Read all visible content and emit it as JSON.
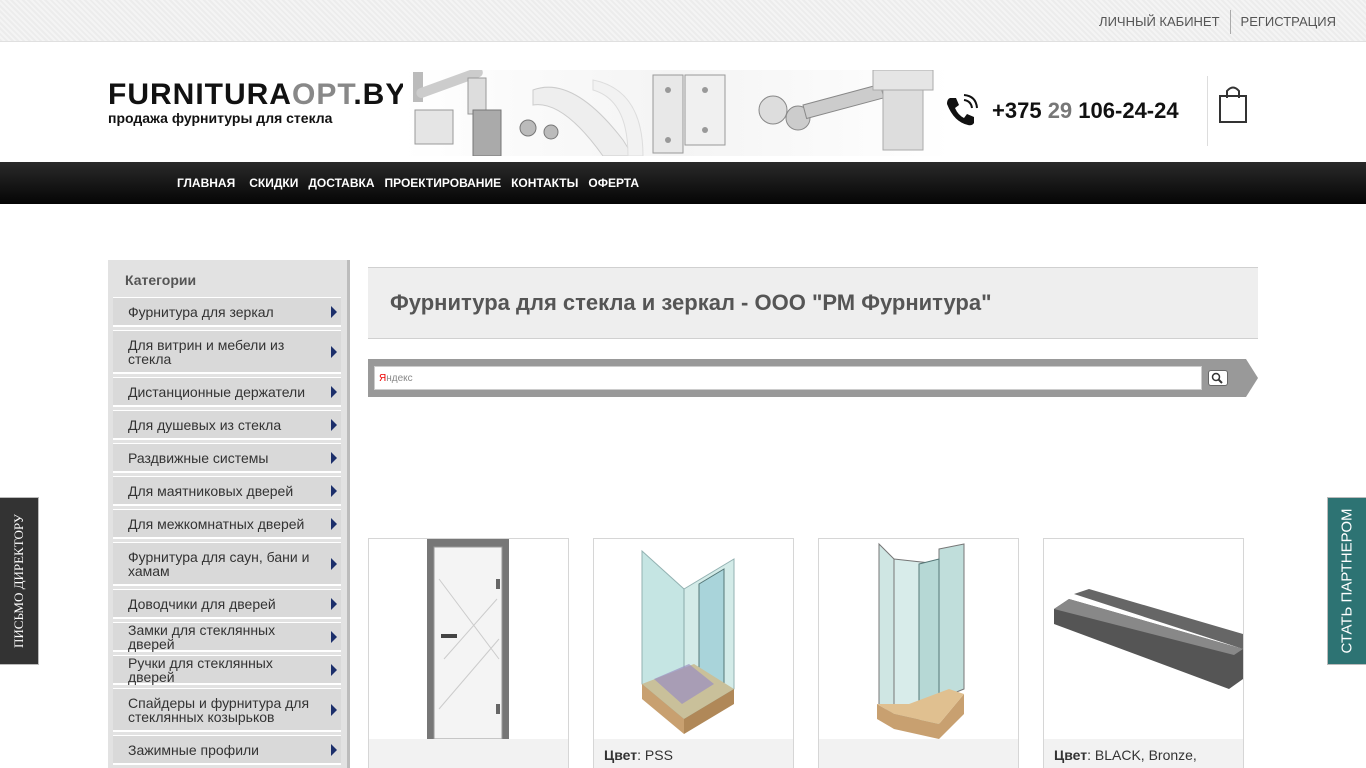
{
  "topbar": {
    "cabinet": "ЛИЧНЫЙ КАБИНЕТ",
    "register": "РЕГИСТРАЦИЯ"
  },
  "logo": {
    "part1": "FURNITURA",
    "part2": "OPT",
    "part3": ".BY",
    "tagline": "продажа фурнитуры для стекла"
  },
  "phone": {
    "prefix": "+375",
    "code": "29",
    "number": "106-24-24"
  },
  "nav": [
    "ГЛАВНАЯ",
    "СКИДКИ",
    "ДОСТАВКА",
    "ПРОЕКТИРОВАНИЕ",
    "КОНТАКТЫ",
    "ОФЕРТА"
  ],
  "sidebar": {
    "title": "Категории",
    "items": [
      "Фурнитура для зеркал",
      "Для витрин и мебели из стекла",
      "Дистанционные держатели",
      "Для душевых из стекла",
      "Раздвижные системы",
      "Для маятниковых дверей",
      "Для межкомнатных дверей",
      "Фурнитура для саун, бани и хамам",
      "Доводчики для дверей",
      "Замки для стеклянных дверей",
      "Ручки для стеклянных дверей",
      "Спайдеры и фурнитура для стеклянных козырьков",
      "Зажимные профили"
    ]
  },
  "main": {
    "title": "Фурнитура для стекла и зеркал - ООО \"РМ Фурнитура\"",
    "search_brand_y": "Я",
    "search_brand_rest": "ндекс"
  },
  "products": [
    {
      "label": "",
      "value": ""
    },
    {
      "label": "Цвет",
      "value": ": PSS"
    },
    {
      "label": "",
      "value": ""
    },
    {
      "label": "Цвет",
      "value": ": BLACK, Bronze,"
    }
  ],
  "tabs": {
    "left": "ПИСЬМО ДИРЕКТОРУ",
    "right": "СТАТЬ ПАРТНЕРОМ"
  }
}
